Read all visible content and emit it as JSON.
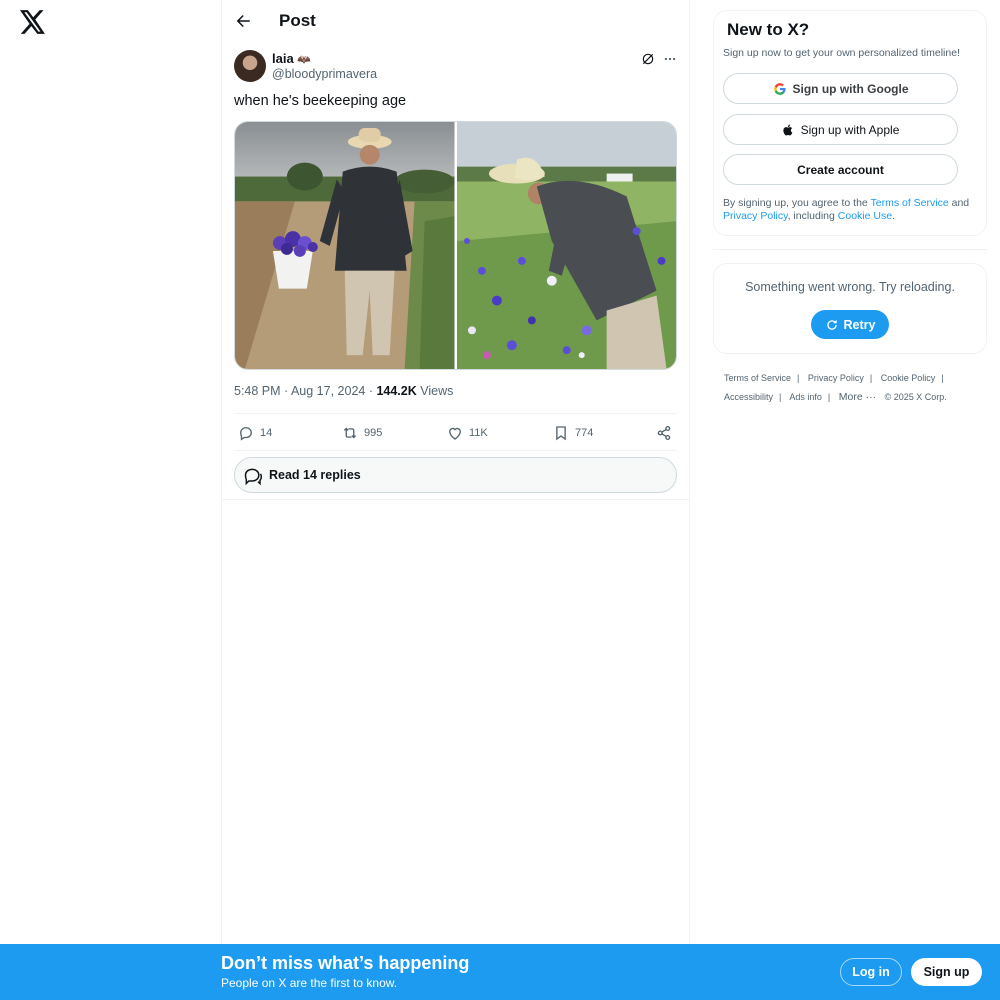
{
  "header": {
    "title": "Post"
  },
  "post": {
    "author_name": "laia",
    "author_badge": "🦇",
    "author_handle": "@bloodyprimavera",
    "text": "when he's beekeeping age",
    "time": "5:48 PM · Aug 17, 2024 · ",
    "views_count": "144.2K",
    "views_label": " Views",
    "stats": {
      "replies": "14",
      "reposts": "995",
      "likes": "11K",
      "bookmarks": "774"
    },
    "read_replies": "Read 14 replies"
  },
  "signup": {
    "title": "New to X?",
    "subtitle": "Sign up now to get your own personalized timeline!",
    "google_label": "Sign up with Google",
    "apple_label": "Sign up with Apple",
    "create_label": "Create account",
    "legal_prefix": "By signing up, you agree to the ",
    "legal_tos": "Terms of Service",
    "legal_and": " and ",
    "legal_privacy": "Privacy Policy",
    "legal_including": ", including ",
    "legal_cookie": "Cookie Use",
    "legal_end": "."
  },
  "error": {
    "message": "Something went wrong. Try reloading.",
    "retry_label": "Retry"
  },
  "footer": {
    "terms": "Terms of Service",
    "privacy": "Privacy Policy",
    "cookie": "Cookie Policy",
    "accessibility": "Accessibility",
    "ads": "Ads info",
    "more": "More ···",
    "copyright": "© 2025 X Corp."
  },
  "bottom_bar": {
    "title": "Don’t miss what’s happening",
    "subtitle": "People on X are the first to know.",
    "login_label": "Log in",
    "signup_label": "Sign up"
  },
  "colors": {
    "accent": "#1d9bf0",
    "text_primary": "#0f1419",
    "text_secondary": "#536471"
  },
  "icons": [
    "x-logo-icon",
    "back-arrow-icon",
    "grok-icon",
    "more-icon",
    "reply-icon",
    "repost-icon",
    "like-icon",
    "bookmark-icon",
    "share-icon",
    "replies-bubble-icon",
    "google-icon",
    "apple-icon",
    "refresh-icon"
  ]
}
